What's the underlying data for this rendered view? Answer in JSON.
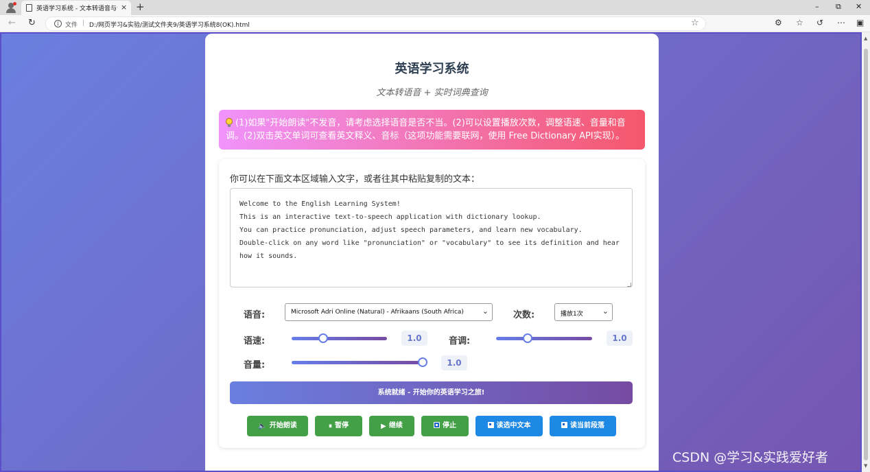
{
  "browser": {
    "tab_title": "英语学习系统 - 文本转语音与词典",
    "tab_close": "×",
    "new_tab": "+",
    "minimize": "–",
    "restore": "⧉",
    "close": "✕",
    "file_label": "文件",
    "separator": "|",
    "url": "D:/网页学习&实验/测试文件夹9/英语学习系统8(OK).html"
  },
  "page": {
    "title": "英语学习系统",
    "subtitle": "文本转语音 + 实时词典查询",
    "tip": "(1)如果\"开始朗读\"不发音，请考虑选择语音是否不当。(2)可以设置播放次数，调整语速、音量和音调。(2)双击英文单词可查看英文释义、音标（这项功能需要联网，使用 Free Dictionary API实现）。",
    "prompt": "你可以在下面文本区域输入文字，或者往其中粘贴复制的文本：",
    "text_lines": [
      "Welcome to the English Learning System!",
      "This is an interactive text-to-speech application with dictionary lookup.",
      "You can practice pronunciation, adjust speech parameters, and learn new vocabulary.",
      "Double-click on any word like \"pronunciation\" or \"vocabulary\" to see its definition and hear",
      "how it sounds."
    ],
    "controls": {
      "voice_label": "语音:",
      "voice_value": "Microsoft Adri Online (Natural) - Afrikaans (South Africa)",
      "times_label": "次数:",
      "times_value": "播放1次",
      "rate_label": "语速:",
      "rate_value": "1.0",
      "rate_fraction": 0.33,
      "pitch_label": "音调:",
      "pitch_value": "1.0",
      "pitch_fraction": 0.33,
      "volume_label": "音量:",
      "volume_value": "1.0",
      "volume_fraction": 1.0
    },
    "status": "系统就绪 - 开始你的英语学习之旅!",
    "buttons": {
      "start": "开始朗读",
      "pause": "暂停",
      "resume": "继续",
      "stop": "停止",
      "read_selected": "读选中文本",
      "read_paragraph": "读当前段落"
    }
  },
  "watermark": "CSDN @学习&实践爱好者",
  "colors": {
    "accent_start": "#667eea",
    "accent_end": "#764ba2",
    "tip_start": "#f093fb",
    "tip_end": "#f5576c",
    "green_button": "#43a047",
    "blue_button": "#1e88e5"
  }
}
